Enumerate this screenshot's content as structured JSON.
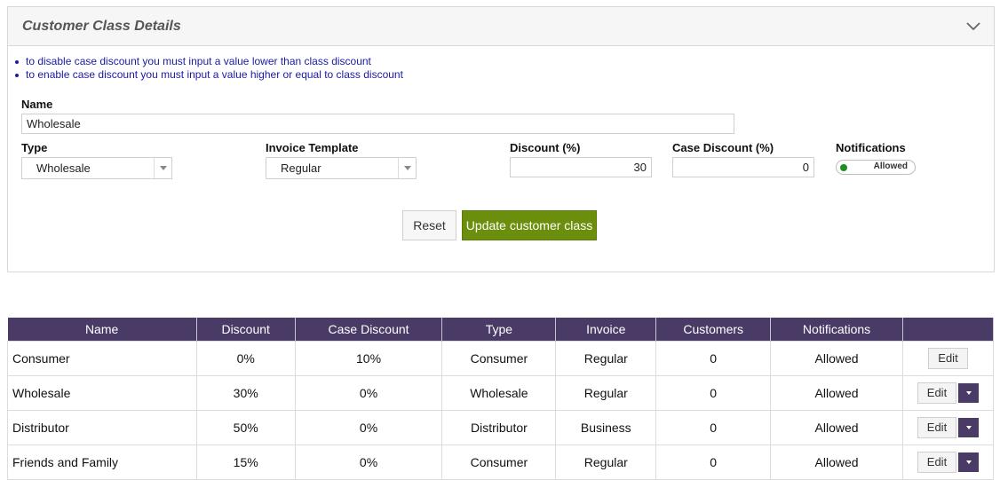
{
  "panel": {
    "title": "Customer Class Details",
    "notes": [
      "to disable case discount you must input a value lower than class discount",
      "to enable case discount you must input a value higher or equal to class discount"
    ]
  },
  "form": {
    "name_label": "Name",
    "name_value": "Wholesale",
    "type_label": "Type",
    "type_value": "Wholesale",
    "invoice_label": "Invoice Template",
    "invoice_value": "Regular",
    "discount_label": "Discount (%)",
    "discount_value": "30",
    "case_discount_label": "Case Discount (%)",
    "case_discount_value": "0",
    "notifications_label": "Notifications",
    "notifications_value": "Allowed",
    "reset_label": "Reset",
    "update_label": "Update customer class"
  },
  "table": {
    "headers": [
      "Name",
      "Discount",
      "Case Discount",
      "Type",
      "Invoice",
      "Customers",
      "Notifications",
      ""
    ],
    "edit_label": "Edit",
    "rows": [
      {
        "name": "Consumer",
        "discount": "0%",
        "case_discount": "10%",
        "type": "Consumer",
        "invoice": "Regular",
        "customers": "0",
        "notifications": "Allowed",
        "has_menu": false
      },
      {
        "name": "Wholesale",
        "discount": "30%",
        "case_discount": "0%",
        "type": "Wholesale",
        "invoice": "Regular",
        "customers": "0",
        "notifications": "Allowed",
        "has_menu": true
      },
      {
        "name": "Distributor",
        "discount": "50%",
        "case_discount": "0%",
        "type": "Distributor",
        "invoice": "Business",
        "customers": "0",
        "notifications": "Allowed",
        "has_menu": true
      },
      {
        "name": "Friends and Family",
        "discount": "15%",
        "case_discount": "0%",
        "type": "Consumer",
        "invoice": "Regular",
        "customers": "0",
        "notifications": "Allowed",
        "has_menu": true
      }
    ]
  },
  "colors": {
    "header_bg": "#4a3a66",
    "update_button": "#6b8e0d",
    "note_text": "#1a1aa8",
    "toggle_dot": "#1f8f1f"
  }
}
